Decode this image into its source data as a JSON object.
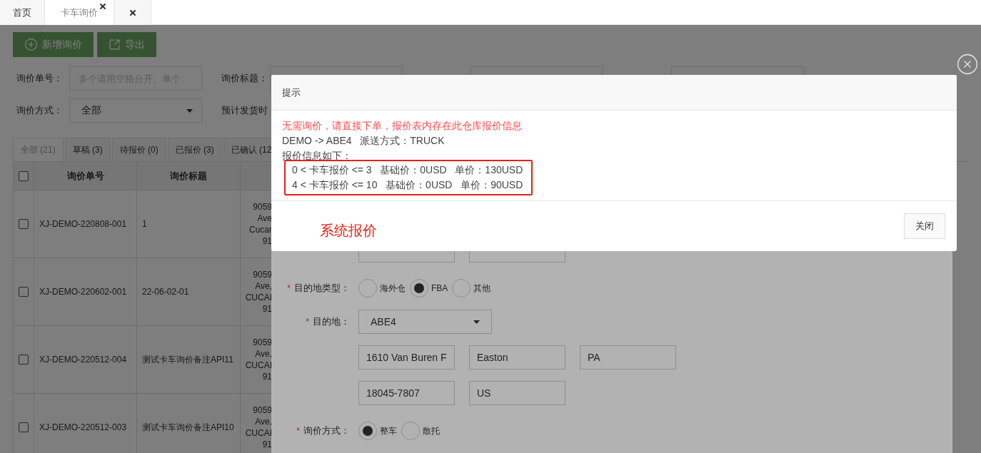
{
  "page_tabs": [
    {
      "label": "首页",
      "selected": false,
      "closable": false
    },
    {
      "label": "卡车询价",
      "selected": true,
      "closable": true
    },
    {
      "selected": false,
      "closable": true
    }
  ],
  "toolbar": {
    "buttons": [
      {
        "label": "新增询价",
        "kind": "add"
      },
      {
        "label": "导出",
        "kind": "export"
      }
    ]
  },
  "filters": [
    {
      "kind": "input",
      "label": "询价单号：",
      "placeholder": "多个请用空格分开。单个"
    },
    {
      "kind": "input",
      "label": "询价标题："
    },
    {
      "kind": "input"
    },
    {
      "kind": "input"
    },
    {
      "kind": "select",
      "label": "询价方式：",
      "value": "全部"
    },
    {
      "kind": "label",
      "label": "预计发货时"
    }
  ],
  "status_tabs": [
    {
      "label": "全部 (21)",
      "selected": true
    },
    {
      "label": "草稿 (3)",
      "selected": false
    },
    {
      "label": "待报价 (0)",
      "selected": false
    },
    {
      "label": "已报价 (3)",
      "selected": false
    },
    {
      "label": "已确认 (12",
      "selected": false
    }
  ],
  "table": {
    "header_checked": false,
    "columns": [
      "询价单号",
      "询价标题"
    ],
    "rows": [
      {
        "checked": false,
        "cells": [
          "XJ-DEMO-220808-001",
          "1",
          "9059 Ave Cucar 91"
        ]
      },
      {
        "checked": false,
        "cells": [
          "XJ-DEMO-220602-001",
          "22-06-02-01",
          "9059 Ave, CUCAI 91"
        ]
      },
      {
        "checked": false,
        "cells": [
          "XJ-DEMO-220512-004",
          "测试卡车询价备注API11",
          "9059 Ave, CUCAI 91"
        ]
      },
      {
        "checked": false,
        "cells": [
          "XJ-DEMO-220512-003",
          "测试卡车询价备注API10",
          "9059 Ave, CUCAI 91"
        ]
      }
    ]
  },
  "form": [
    {
      "kind": "radio",
      "required_mark": "*",
      "label": "目的地类型：",
      "options": [
        {
          "label": "海外仓",
          "selected": false
        },
        {
          "label": "FBA",
          "selected": true
        },
        {
          "label": "其他",
          "selected": false
        }
      ]
    },
    {
      "kind": "select",
      "required_mark": "*",
      "label": "目的地：",
      "value": "ABE4"
    },
    {
      "kind": "fields",
      "values": [
        "1610 Van Buren F",
        "Easton",
        "PA"
      ]
    },
    {
      "kind": "fields",
      "values": [
        "18045-7807",
        "US"
      ]
    },
    {
      "kind": "radio",
      "required_mark": "*",
      "label": "询价方式：",
      "options": [
        {
          "label": "整车",
          "selected": true
        },
        {
          "label": "散托",
          "selected": false
        }
      ]
    }
  ],
  "dialog": {
    "title": "提示",
    "warning": "无需询价，请直接下单，报价表内存在此仓库报价信息",
    "lines": [
      "DEMO -> ABE4   派送方式：TRUCK",
      "报价信息如下："
    ],
    "quotes": [
      "0 < 卡车报价 <= 3   基础价：0USD   单价：130USD",
      "4 < 卡车报价 <= 10   基础价：0USD   单价：90USD"
    ],
    "annotation": "系统报价",
    "buttons": [
      "关闭"
    ]
  }
}
